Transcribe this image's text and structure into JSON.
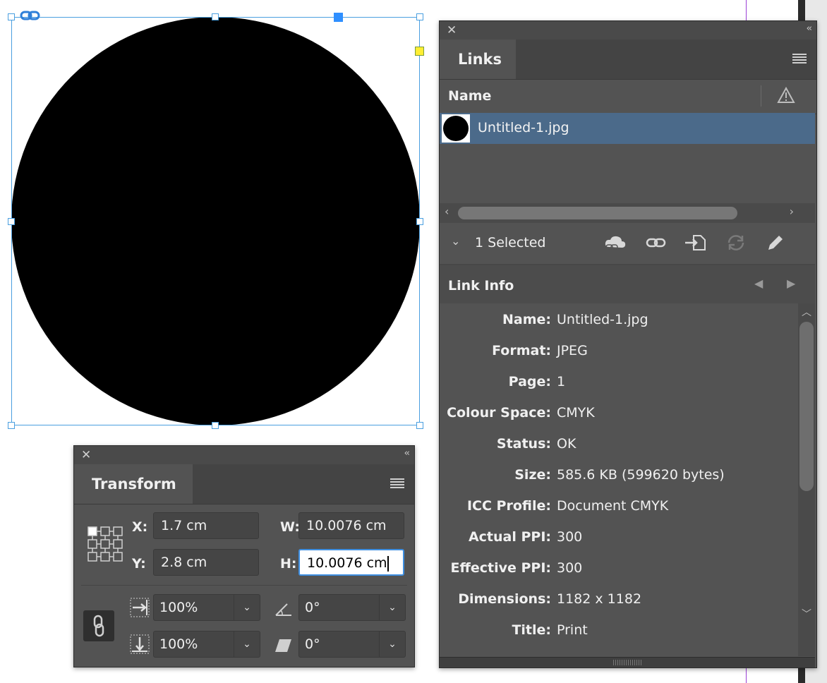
{
  "canvas": {
    "colors": {
      "selection": "#4a9fe0",
      "guide": "#9b3fd6"
    }
  },
  "links_panel": {
    "tab_title": "Links",
    "column_name": "Name",
    "items": [
      {
        "name": "Untitled-1.jpg"
      }
    ],
    "selection_summary": "1 Selected",
    "toolbar_icons": [
      "cloud-link-icon",
      "relink-icon",
      "go-to-link-icon",
      "update-link-icon",
      "edit-original-icon"
    ],
    "link_info": {
      "title": "Link Info",
      "rows": [
        {
          "label": "Name:",
          "value": "Untitled-1.jpg"
        },
        {
          "label": "Format:",
          "value": "JPEG"
        },
        {
          "label": "Page:",
          "value": "1"
        },
        {
          "label": "Colour Space:",
          "value": "CMYK"
        },
        {
          "label": "Status:",
          "value": "OK"
        },
        {
          "label": "Size:",
          "value": "585.6 KB (599620 bytes)"
        },
        {
          "label": "ICC Profile:",
          "value": "Document CMYK"
        },
        {
          "label": "Actual PPI:",
          "value": "300"
        },
        {
          "label": "Effective PPI:",
          "value": "300"
        },
        {
          "label": "Dimensions:",
          "value": "1182 x 1182"
        },
        {
          "label": "Title:",
          "value": "Print"
        }
      ]
    },
    "colors": {
      "row_selected": "#4b6a8a",
      "panel_bg": "#535353"
    }
  },
  "transform_panel": {
    "tab_title": "Transform",
    "x_label": "X:",
    "x_value": "1.7 cm",
    "y_label": "Y:",
    "y_value": "2.8 cm",
    "w_label": "W:",
    "w_value": "10.0076 cm",
    "h_label": "H:",
    "h_value": "10.0076 cm",
    "scale_x": "100%",
    "scale_y": "100%",
    "rotation": "0°",
    "shear": "0°"
  }
}
